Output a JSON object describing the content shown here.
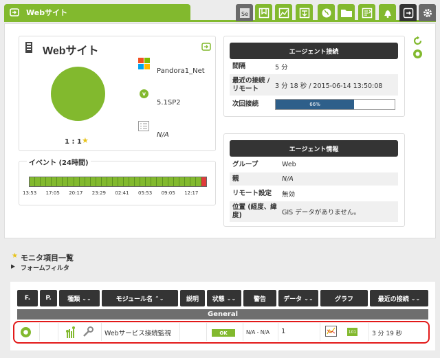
{
  "header": {
    "title": "Webサイト",
    "icons": [
      "snapshot-icon",
      "manage-icon",
      "chart-icon",
      "export-icon",
      "gis-icon",
      "folder-icon",
      "alerts-icon",
      "bell-icon",
      "exit-icon",
      "settings-icon"
    ]
  },
  "agent": {
    "name": "Webサイト",
    "os_name": "Pandora1_Net",
    "version": "5.1SP2",
    "description": "N/A",
    "ratio": "1 : 1",
    "status_color": "#82b92e"
  },
  "events": {
    "title": "イベント (24時間)",
    "ticks": [
      "13:53",
      "17:05",
      "20:17",
      "23:29",
      "02:41",
      "05:53",
      "09:05",
      "12:17"
    ]
  },
  "contact": {
    "header": "エージェント接続",
    "rows": [
      {
        "k": "間隔",
        "v": "5 分"
      },
      {
        "k": "最近の接続 / リモート",
        "v": "3 分 18 秒 / 2015-06-14 13:50:08"
      },
      {
        "k": "次回接続",
        "v": ""
      }
    ],
    "progress_label": "66%",
    "progress_value": 0.66
  },
  "info": {
    "header": "エージェント情報",
    "rows": [
      {
        "k": "グループ",
        "v": "Web"
      },
      {
        "k": "親",
        "v": "N/A"
      },
      {
        "k": "リモート設定",
        "v": "無効"
      },
      {
        "k": "位置 (経度、緯度)",
        "v": "GIS データがありません。"
      }
    ]
  },
  "monitors": {
    "title": "モニタ項目一覧",
    "filter": "フォームフィルタ",
    "columns": [
      "F.",
      "P.",
      "種類",
      "モジュール名",
      "説明",
      "状態",
      "警告",
      "データ",
      "グラフ",
      "最近の接続"
    ],
    "group": "General",
    "row": {
      "module": "Webサービス接続監視",
      "status": "OK",
      "warning": "N/A - N/A",
      "data": "1",
      "graph_badge": "101",
      "last_contact": "3 分 19 秒"
    }
  },
  "colors": {
    "accent": "#82b92e",
    "dark": "#343434",
    "alert": "#e21919",
    "progress": "#2e5f8a"
  }
}
